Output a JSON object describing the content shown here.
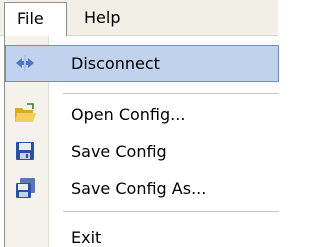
{
  "menubar": {
    "file_label": "File",
    "help_label": "Help"
  },
  "file_menu": {
    "items": [
      {
        "label": "Disconnect",
        "icon": "disconnect-icon",
        "selected": true
      },
      {
        "label": "Open Config...",
        "icon": "open-folder-icon"
      },
      {
        "label": "Save Config",
        "icon": "save-disk-icon"
      },
      {
        "label": "Save Config As...",
        "icon": "save-as-icon"
      },
      {
        "label": "Exit",
        "icon": ""
      }
    ]
  },
  "colors": {
    "selection_fill": "#c1d2ee",
    "selection_border": "#6f8ec9",
    "menubar_bg": "#f1efe6"
  }
}
